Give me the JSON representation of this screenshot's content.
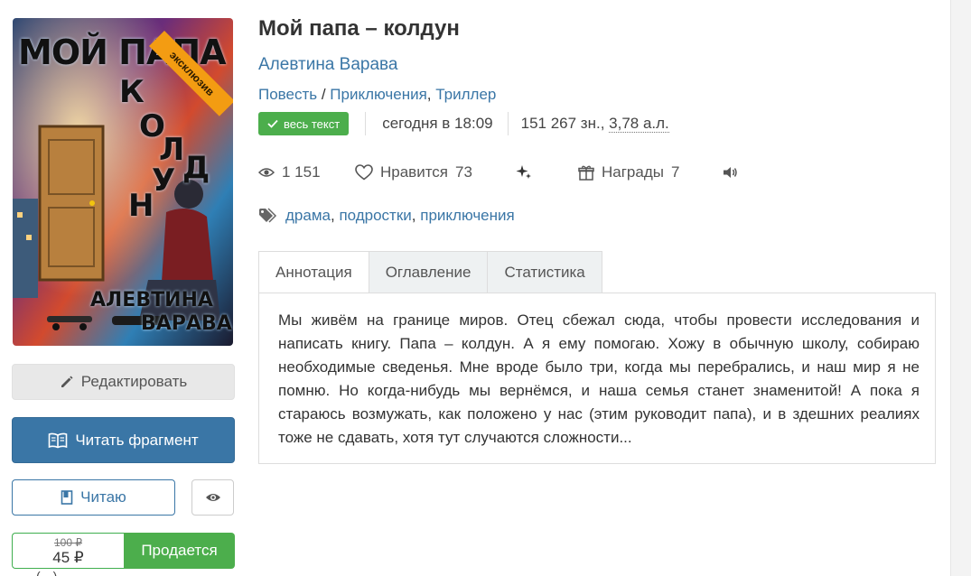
{
  "book": {
    "title": "Мой папа – колдун",
    "author": "Алевтина Варава",
    "genres": [
      "Повесть",
      "Приключения",
      "Триллер"
    ],
    "genre_sep1": " / ",
    "genre_sep2": ", ",
    "full_text_badge": "весь текст",
    "updated": "сегодня в 18:09",
    "size_chars": "151 267 зн., ",
    "size_sheets": "3,78 а.л."
  },
  "cover": {
    "ribbon_label": "эксклюзив",
    "title_line": "МОЙ ПАПА",
    "title_vertical": [
      "К",
      "О",
      "Л",
      "Д",
      "У",
      "Н"
    ],
    "author_lines": [
      "АЛЕВТИНА",
      "ВАРАВА"
    ]
  },
  "stats": {
    "views": "1 151",
    "likes_label": "Нравится",
    "likes_count": "73",
    "awards_label": "Награды",
    "awards_count": "7"
  },
  "tags": [
    "драма",
    "подростки",
    "приключения"
  ],
  "tag_sep": ", ",
  "tabs": [
    {
      "label": "Аннотация",
      "active": true
    },
    {
      "label": "Оглавление",
      "active": false
    },
    {
      "label": "Статистика",
      "active": false
    }
  ],
  "annotation": "Мы живём на границе миров. Отец сбежал сюда, чтобы провести исследования и написать книгу. Папа – колдун. А я ему помогаю. Хожу в обычную школу, собираю необходимые сведенья. Мне вроде было три, когда мы перебрались, и наш мир я не помню. Но когда-нибудь мы вернёмся, и наша семья станет знаменитой! А пока я стараюсь возмужать, как положено у нас (этим руководит папа), и в здешних реалиях тоже не сдавать, хотя тут случаются сложности...",
  "actions": {
    "edit_label": "Редактировать",
    "read_fragment_label": "Читать фрагмент",
    "reading_label": "Читаю",
    "old_price": "100 ₽",
    "new_price": "45 ₽",
    "sale_label": "Продается",
    "cut_text": "(…)"
  },
  "colors": {
    "link": "#3a76a6",
    "primary_button": "#3a76a6",
    "success": "#4cae4c",
    "ribbon": "#f39c12"
  },
  "icons": [
    "check-icon",
    "eye-icon",
    "heart-icon",
    "sparkles-icon",
    "gift-icon",
    "speaker-icon",
    "tag-icon",
    "pencil-icon",
    "book-open-icon",
    "bookmark-icon"
  ]
}
